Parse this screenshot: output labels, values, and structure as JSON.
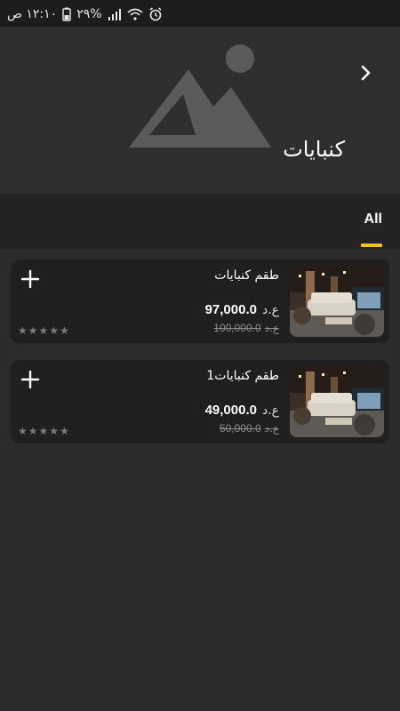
{
  "status_bar": {
    "time": "١٢:١٠ ص",
    "battery": "٢٩%",
    "icons": [
      "alarm-icon",
      "wifi-icon",
      "signal-icon",
      "battery-icon"
    ]
  },
  "header": {
    "title": "كنبايات",
    "back_icon": "chevron-right-icon",
    "image_icon": "image-placeholder-icon"
  },
  "tabs": [
    {
      "label": "All",
      "active": true
    }
  ],
  "colors": {
    "accent": "#f4c21b",
    "background": "#2b2b2b",
    "card": "#1f1f1f"
  },
  "products": [
    {
      "name": "طقم كنبايات",
      "currency": "ع.د",
      "price": "97,000.0",
      "old_currency": "ع.د",
      "old_price": "100,000.0",
      "rating": 0,
      "max_rating": 5
    },
    {
      "name": "طقم كنبايات1",
      "currency": "ع.د",
      "price": "49,000.0",
      "old_currency": "ع.د",
      "old_price": "50,000.0",
      "rating": 0,
      "max_rating": 5
    }
  ]
}
